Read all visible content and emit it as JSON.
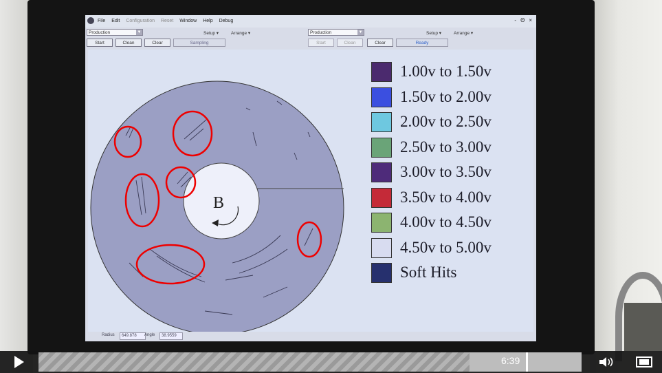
{
  "app": {
    "menu": [
      "File",
      "Edit",
      "Configuration",
      "Reset",
      "Window",
      "Help",
      "Debug"
    ],
    "window_controls": [
      "-",
      "Θ",
      "×"
    ]
  },
  "left_panel": {
    "mode": "Production",
    "setup_label": "Setup",
    "arrange_label": "Arrange",
    "buttons": [
      "Start",
      "Clean",
      "Clear"
    ],
    "status": "Sampling"
  },
  "right_panel": {
    "mode": "Production",
    "setup_label": "Setup",
    "arrange_label": "Arrange",
    "buttons": [
      "Start",
      "Clean",
      "Clear"
    ],
    "status": "Ready"
  },
  "disc": {
    "label": "B",
    "rotation": "counter-clockwise"
  },
  "legend": [
    {
      "label": "1.00v to 1.50v",
      "color": "#4b2a6e"
    },
    {
      "label": "1.50v to 2.00v",
      "color": "#3b4fe0"
    },
    {
      "label": "2.00v to 2.50v",
      "color": "#6ec8e0"
    },
    {
      "label": "2.50v to 3.00v",
      "color": "#6aa478"
    },
    {
      "label": "3.00v to 3.50v",
      "color": "#4e2b7a"
    },
    {
      "label": "3.50v to 4.00v",
      "color": "#c42a38"
    },
    {
      "label": "4.00v to 4.50v",
      "color": "#8cb470"
    },
    {
      "label": "4.50v to 5.00v",
      "color": "#d8dcf0"
    },
    {
      "label": "Soft Hits",
      "color": "#26306e"
    }
  ],
  "statusbar": {
    "radius_label": "Radius",
    "radius_value": "649.878",
    "angle_label": "Angle",
    "angle_value": "38.9559"
  },
  "player": {
    "time": "6:39",
    "progress_fraction": 0.9
  }
}
